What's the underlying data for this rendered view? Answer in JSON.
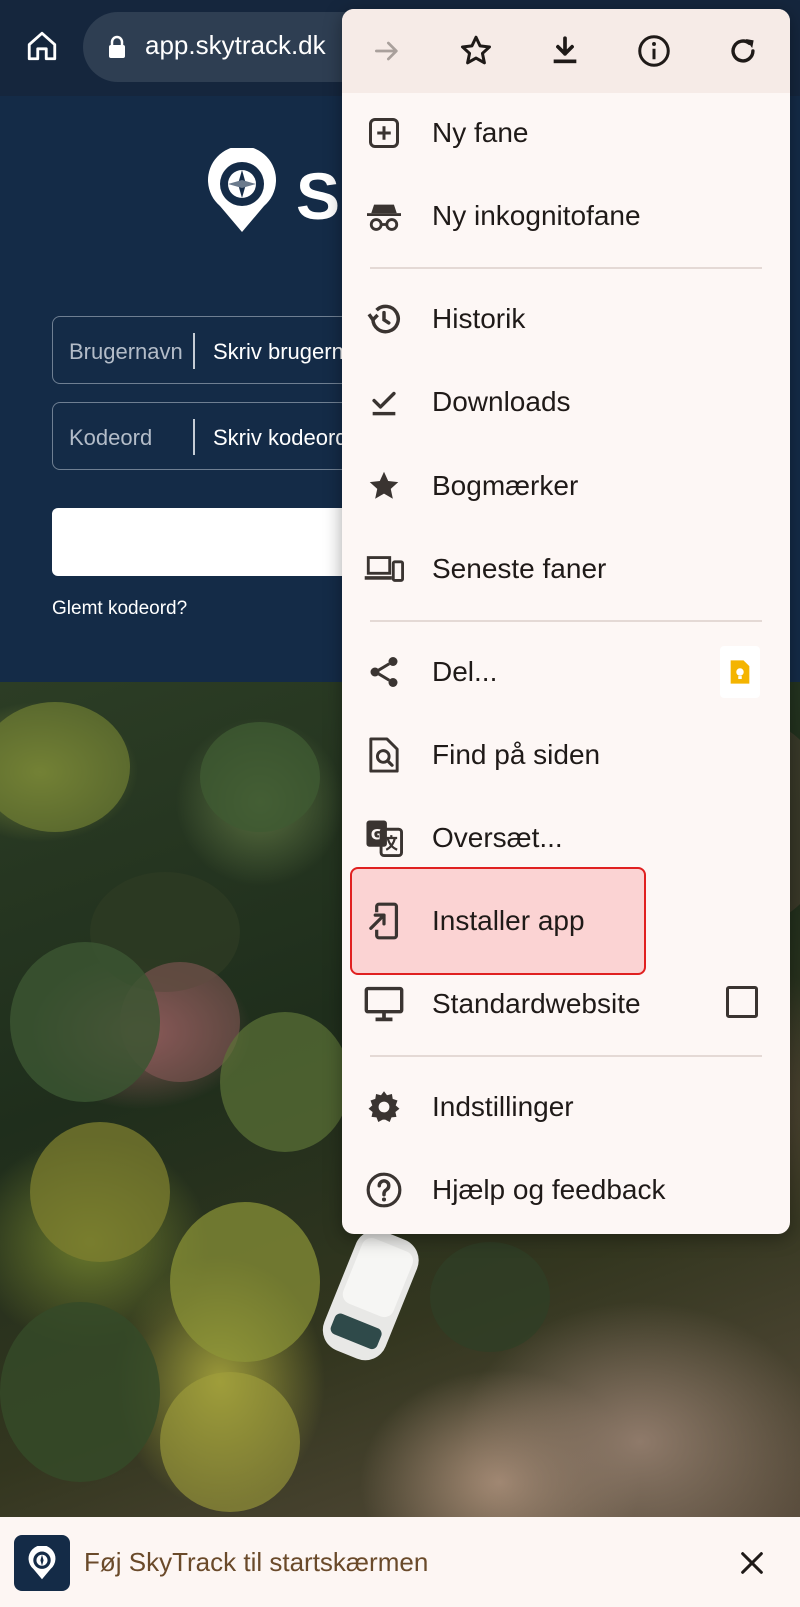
{
  "browser": {
    "url": "app.skytrack.dk",
    "toolbar_icons": [
      "forward-icon",
      "star-icon",
      "download-icon",
      "info-icon",
      "reload-icon"
    ]
  },
  "login": {
    "brand_partial": "Sk",
    "username_label": "Brugernavn",
    "username_placeholder": "Skriv brugern",
    "password_label": "Kodeord",
    "password_placeholder": "Skriv kodeord",
    "forgot_link": "Glemt kodeord?"
  },
  "menu": {
    "items": [
      {
        "label": "Ny fane",
        "icon": "new-tab-icon"
      },
      {
        "label": "Ny inkognitofane",
        "icon": "incognito-icon"
      },
      {
        "label": "Historik",
        "icon": "history-icon"
      },
      {
        "label": "Downloads",
        "icon": "downloads-icon"
      },
      {
        "label": "Bogmærker",
        "icon": "bookmarks-icon"
      },
      {
        "label": "Seneste faner",
        "icon": "recent-tabs-icon"
      },
      {
        "label": "Del...",
        "icon": "share-icon"
      },
      {
        "label": "Find på siden",
        "icon": "find-in-page-icon"
      },
      {
        "label": "Oversæt...",
        "icon": "translate-icon"
      },
      {
        "label": "Installer app",
        "icon": "install-app-icon"
      },
      {
        "label": "Standardwebsite",
        "icon": "desktop-site-icon"
      },
      {
        "label": "Indstillinger",
        "icon": "settings-icon"
      },
      {
        "label": "Hjælp og feedback",
        "icon": "help-icon"
      }
    ],
    "highlight_color": "#e02020",
    "desktop_site_checked": false
  },
  "banner": {
    "text": "Føj SkyTrack til startskærmen"
  }
}
